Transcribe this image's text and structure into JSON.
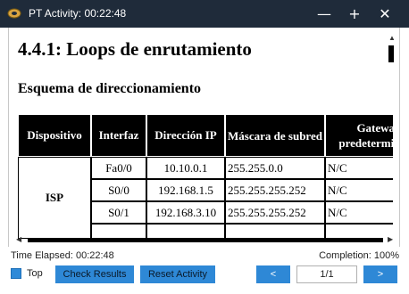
{
  "window": {
    "title": "PT Activity: 00:22:48",
    "minimize": "—",
    "maximize": "+",
    "close": "✕"
  },
  "document": {
    "heading": "4.4.1: Loops de enrutamiento",
    "subheading": "Esquema de direccionamiento"
  },
  "table": {
    "headers": [
      "Dispositivo",
      "Interfaz",
      "Dirección IP",
      "Máscara de subred",
      "Gateway predeterminado"
    ],
    "device": "ISP",
    "rows": [
      [
        "Fa0/0",
        "10.10.0.1",
        "255.255.0.0",
        "N/C"
      ],
      [
        "S0/0",
        "192.168.1.5",
        "255.255.255.252",
        "N/C"
      ],
      [
        "S0/1",
        "192.168.3.10",
        "255.255.255.252",
        "N/C"
      ]
    ]
  },
  "scroll": {
    "left": "◀",
    "right": "▶",
    "up": "▲"
  },
  "status": {
    "elapsed": "Time Elapsed: 00:22:48",
    "completion": "Completion: 100%",
    "top_label": "Top",
    "check_results": "Check Results",
    "reset_activity": "Reset Activity",
    "prev": "<",
    "next": ">",
    "page": "1/1"
  },
  "colors": {
    "titlebar": "#1f2b3a",
    "button": "#2e88d6"
  }
}
